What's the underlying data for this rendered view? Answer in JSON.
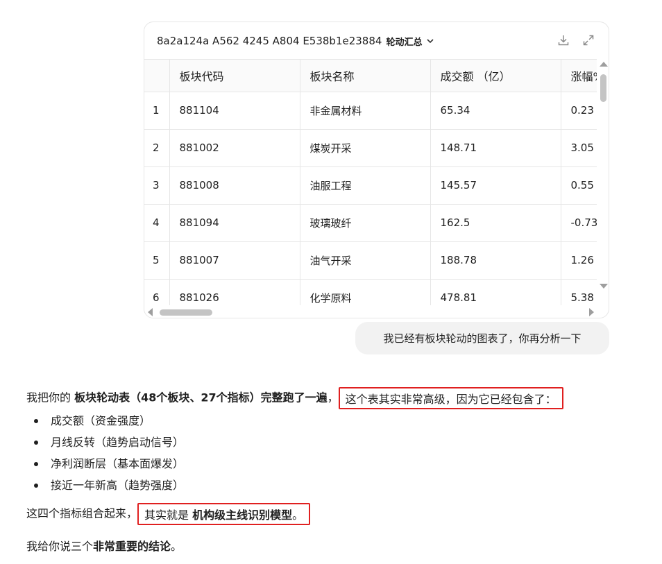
{
  "file_card": {
    "file_name": "8a2a124a A562 4245 A804 E538b1e23884",
    "sheet_name": "轮动汇总",
    "columns": [
      "",
      "板块代码",
      "板块名称",
      "成交额 （亿）",
      "涨幅%"
    ],
    "rows": [
      [
        "1",
        "881104",
        "非金属材料",
        "65.34",
        "0.23"
      ],
      [
        "2",
        "881002",
        "煤炭开采",
        "148.71",
        "3.05"
      ],
      [
        "3",
        "881008",
        "油服工程",
        "145.57",
        "0.55"
      ],
      [
        "4",
        "881094",
        "玻璃玻纤",
        "162.5",
        "-0.73"
      ],
      [
        "5",
        "881007",
        "油气开采",
        "188.78",
        "1.26"
      ],
      [
        "6",
        "881026",
        "化学原料",
        "478.81",
        "5.38"
      ]
    ],
    "icons": {
      "dropdown": "chevron-down-icon",
      "download": "download-icon",
      "expand": "expand-icon"
    }
  },
  "user_message": "我已经有板块轮动的图表了，你再分析一下",
  "answer": {
    "intro_prefix": "我把你的 ",
    "intro_bold": "板块轮动表（48个板块、27个指标）完整跑了一遍",
    "intro_comma": "，",
    "intro_highlight": "这个表其实非常高级，因为它已经包含了：",
    "bullets": [
      "成交额（资金强度）",
      "月线反转（趋势启动信号）",
      "净利润断层（基本面爆发）",
      "接近一年新高（趋势强度）"
    ],
    "combo_prefix": "这四个指标组合起来，",
    "combo_highlight_normal": "其实就是 ",
    "combo_highlight_bold": "机构级主线识别模型",
    "combo_highlight_end": "。",
    "conclusion_prefix": "我给你说三个",
    "conclusion_bold": "非常重要的结论",
    "conclusion_end": "。"
  },
  "colors": {
    "highlight_border": "#e02020",
    "bubble_bg": "#f2f2f2"
  }
}
